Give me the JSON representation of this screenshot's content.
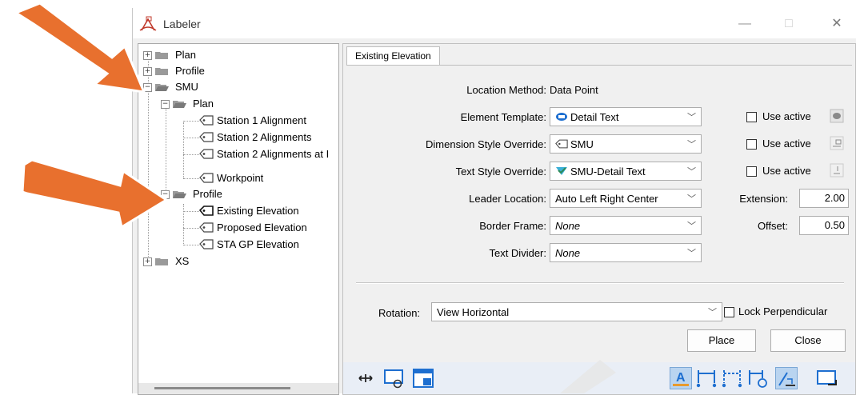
{
  "window": {
    "title": "Labeler",
    "minimize": "—",
    "maximize": "□",
    "close": "✕"
  },
  "tree": {
    "plan": "Plan",
    "profile": "Profile",
    "smu": "SMU",
    "smu_plan": "Plan",
    "station1": "Station 1 Alignment",
    "station2": "Station 2 Alignments",
    "station2_at": "Station 2 Alignments at I",
    "workpoint": "Workpoint",
    "smu_profile": "Profile",
    "existing_elevation": "Existing Elevation",
    "proposed_elevation": "Proposed Elevation",
    "sta_gp_elevation": "STA GP Elevation",
    "xs": "XS"
  },
  "tab": {
    "label": "Existing Elevation"
  },
  "form": {
    "location_method_label": "Location Method:",
    "location_method_value": "Data Point",
    "element_template_label": "Element Template:",
    "element_template_value": "Detail Text",
    "dimension_style_label": "Dimension Style Override:",
    "dimension_style_value": "SMU",
    "text_style_label": "Text Style Override:",
    "text_style_value": "SMU-Detail Text",
    "leader_location_label": "Leader Location:",
    "leader_location_value": "Auto Left Right Center",
    "border_frame_label": "Border Frame:",
    "border_frame_value": "None",
    "text_divider_label": "Text Divider:",
    "text_divider_value": "None",
    "use_active": "Use active",
    "extension_label": "Extension:",
    "extension_value": "2.00",
    "offset_label": "Offset:",
    "offset_value": "0.50",
    "rotation_label": "Rotation:",
    "rotation_value": "View Horizontal",
    "lock_perpendicular": "Lock Perpendicular"
  },
  "buttons": {
    "place": "Place",
    "close": "Close"
  },
  "colors": {
    "arrow": "#e8702e",
    "accent": "#1e6fd0",
    "selection": "#b9d4f0"
  },
  "icons": [
    "title-labeler-icon",
    "folder-icon",
    "label-tag-icon",
    "move-icon",
    "dynamic-view-icon",
    "view-settings-icon",
    "text-label-icon",
    "dimension-icon",
    "dimension-dashed-icon",
    "dimension-point-icon",
    "slope-label-icon",
    "selection-box-icon"
  ]
}
